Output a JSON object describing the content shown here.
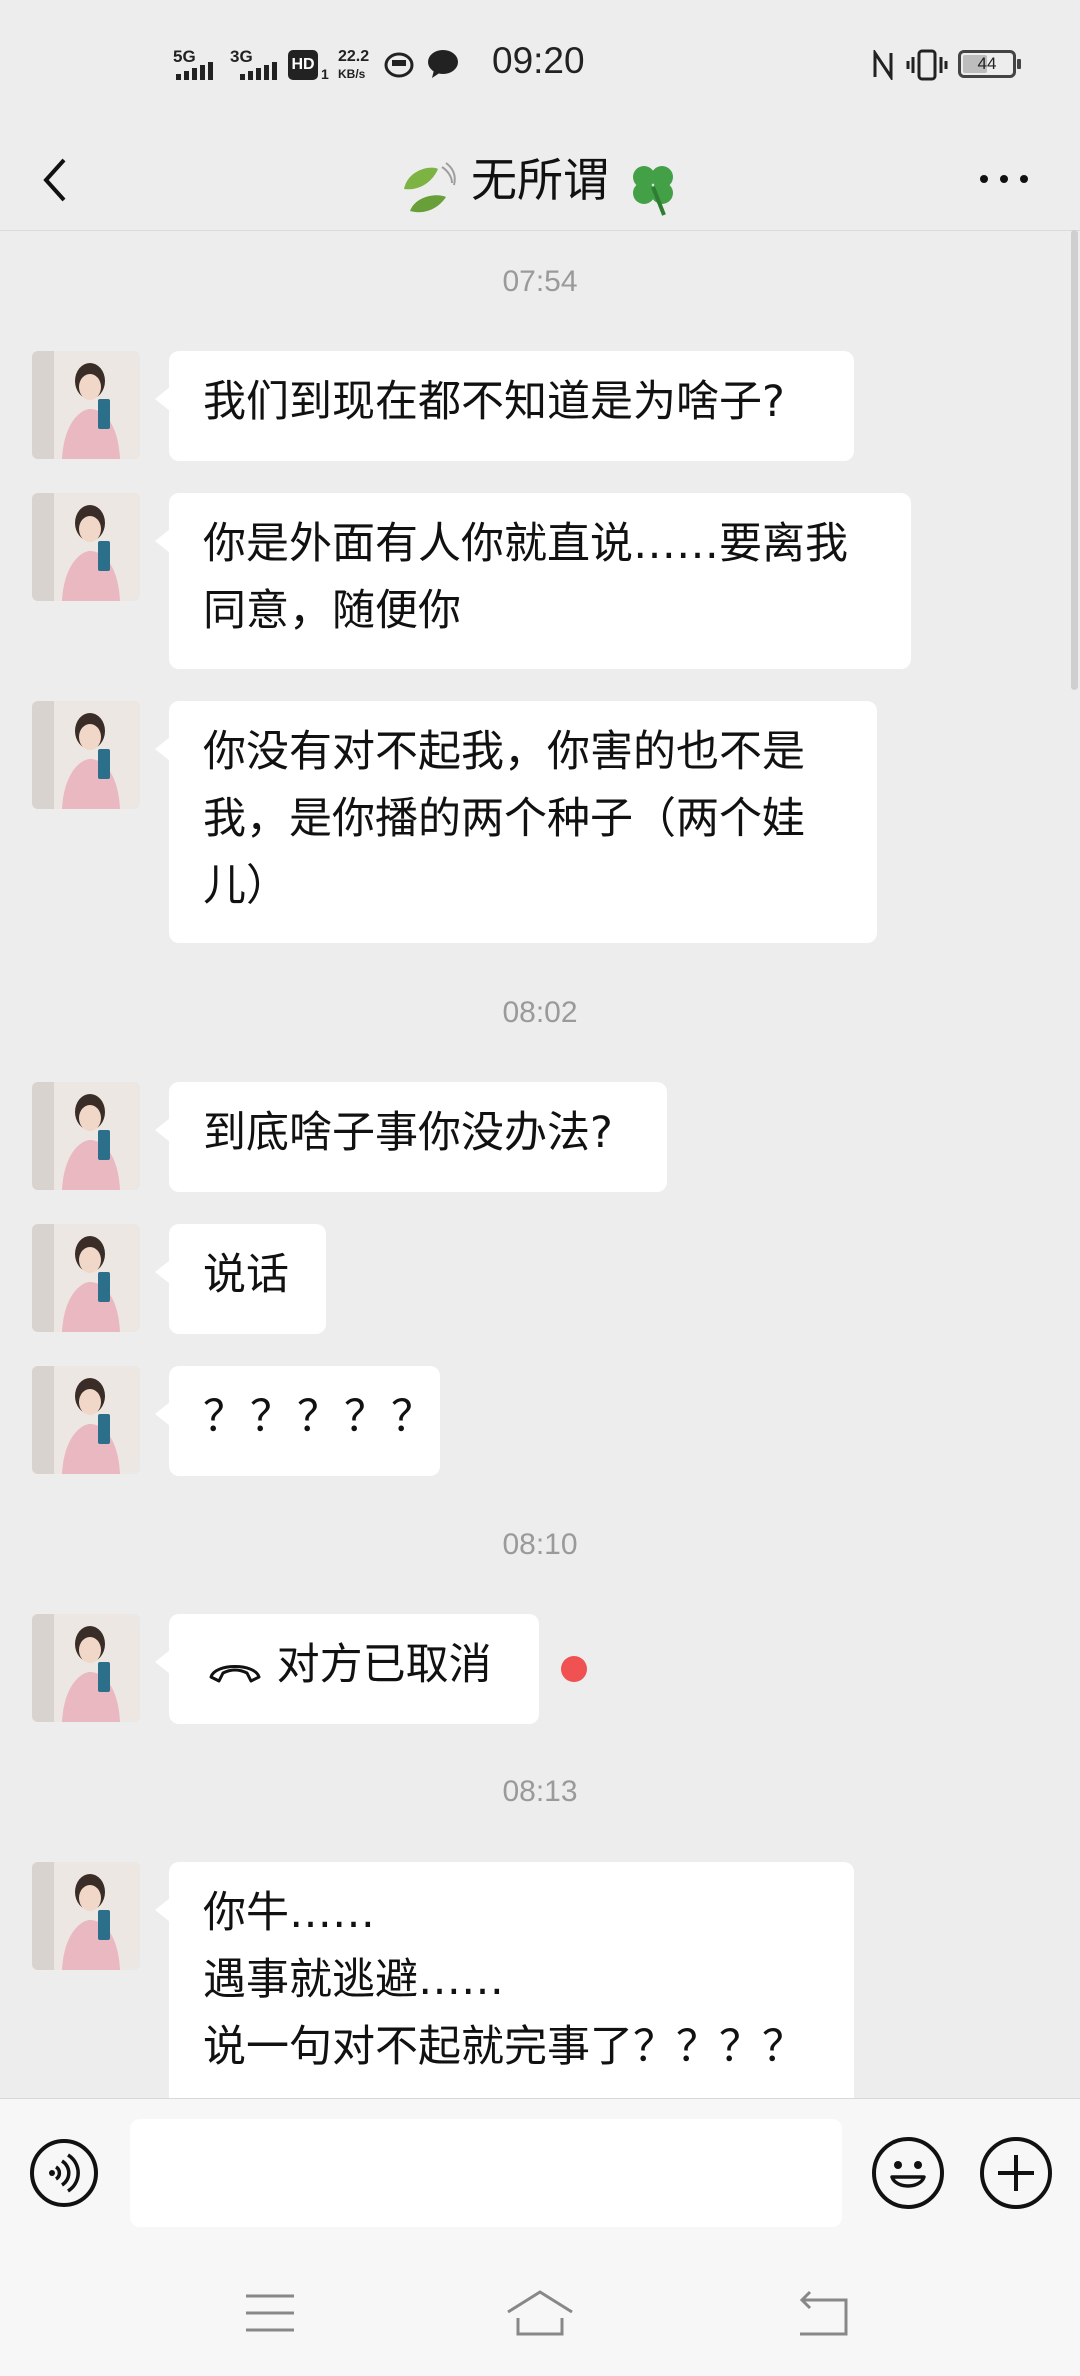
{
  "status": {
    "sig1": "5G",
    "sig2": "3G",
    "hd": "HD",
    "hd_sub": "1",
    "speed_val": "22.2",
    "speed_unit": "KB/s",
    "time": "09:20",
    "battery": "44"
  },
  "header": {
    "title": "无所谓",
    "back_icon": "chevron-left-icon",
    "more_icon": "ellipsis-icon"
  },
  "messages": [
    {
      "type": "time",
      "text": "07:54"
    },
    {
      "type": "msg",
      "text": "我们到现在都不知道是为啥子?"
    },
    {
      "type": "msg",
      "text": "你是外面有人你就直说……要离我同意，随便你"
    },
    {
      "type": "msg",
      "text": "你没有对不起我，你害的也不是我，是你播的两个种子（两个娃儿）"
    },
    {
      "type": "time",
      "text": "08:02"
    },
    {
      "type": "msg",
      "text": "到底啥子事你没办法?"
    },
    {
      "type": "msg",
      "text": "说话"
    },
    {
      "type": "msg",
      "text": "？？？？？"
    },
    {
      "type": "time",
      "text": "08:10"
    },
    {
      "type": "call",
      "text": "对方已取消",
      "unread_color": "#f05252"
    },
    {
      "type": "time",
      "text": "08:13"
    },
    {
      "type": "msg",
      "lines": [
        "你牛……",
        "遇事就逃避……",
        "说一句对不起就完事了？？？？"
      ]
    }
  ],
  "input": {
    "voice_icon": "voice-icon",
    "emoji_icon": "emoji-icon",
    "plus_icon": "plus-icon"
  },
  "navkeys": [
    "menu-icon",
    "home-icon",
    "back-icon"
  ]
}
